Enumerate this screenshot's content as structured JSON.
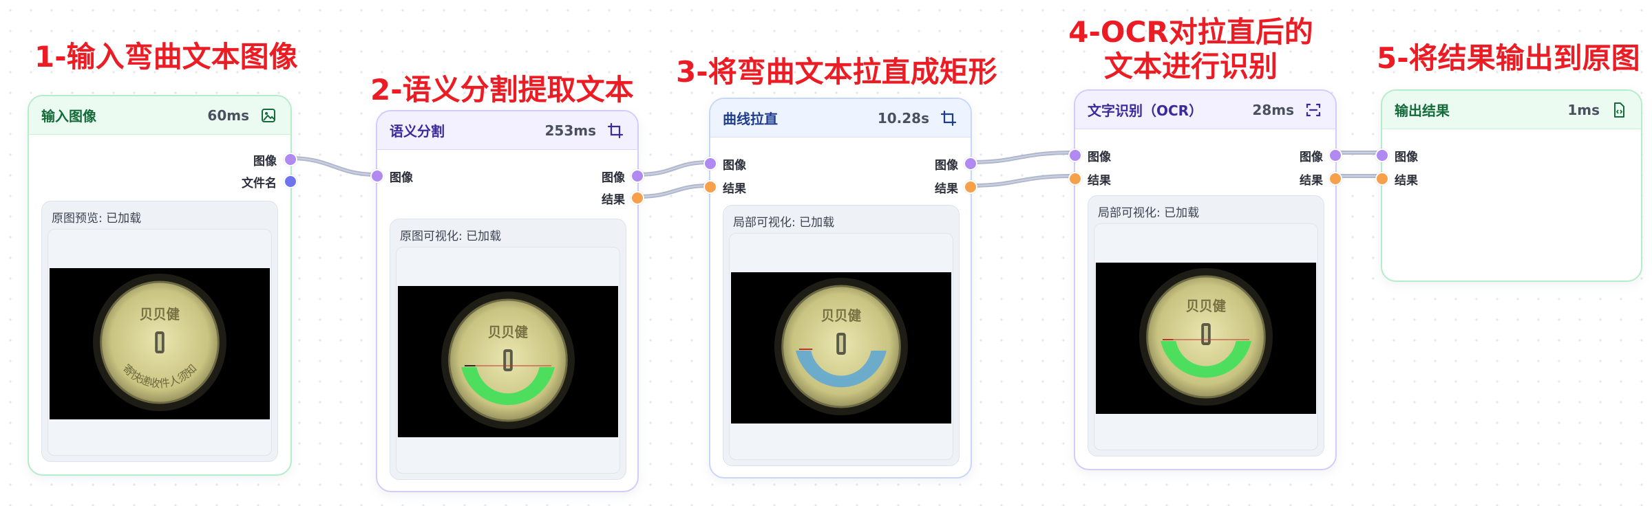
{
  "steps": [
    "1-输入弯曲文本图像",
    "2-语义分割提取文本",
    "3-将弯曲文本拉直成矩形",
    "4-OCR对拉直后的\n文本进行识别",
    "5-将结果输出到原图"
  ],
  "nodes": [
    {
      "title": "输入图像",
      "time": "60ms",
      "icon": "image-icon",
      "outputs": [
        "图像",
        "文件名"
      ],
      "preview": "原图预览: 已加载"
    },
    {
      "title": "语义分割",
      "time": "253ms",
      "icon": "crop-icon",
      "inputs": [
        "图像"
      ],
      "outputs": [
        "图像",
        "结果"
      ],
      "preview": "原图可视化: 已加载"
    },
    {
      "title": "曲线拉直",
      "time": "10.28s",
      "icon": "crop-icon",
      "inputs": [
        "图像",
        "结果"
      ],
      "outputs": [
        "图像",
        "结果"
      ],
      "preview": "局部可视化: 已加载"
    },
    {
      "title": "文字识别（OCR）",
      "time": "28ms",
      "icon": "scan-icon",
      "inputs": [
        "图像",
        "结果"
      ],
      "outputs": [
        "图像",
        "结果"
      ],
      "preview": "局部可视化: 已加载"
    },
    {
      "title": "输出结果",
      "time": "1ms",
      "icon": "file-code-icon",
      "inputs": [
        "图像",
        "结果"
      ]
    }
  ],
  "coin_logo_text": "贝贝健",
  "coin_ring_text": "寄快递收件人须知",
  "colors": {
    "title_red": "#ec1c24",
    "port_image": "#b08af0",
    "port_filename": "#6f74ee",
    "port_result": "#f6a04c",
    "mask_green": "#3fe05a",
    "mask_blue": "#5aa6d6"
  }
}
